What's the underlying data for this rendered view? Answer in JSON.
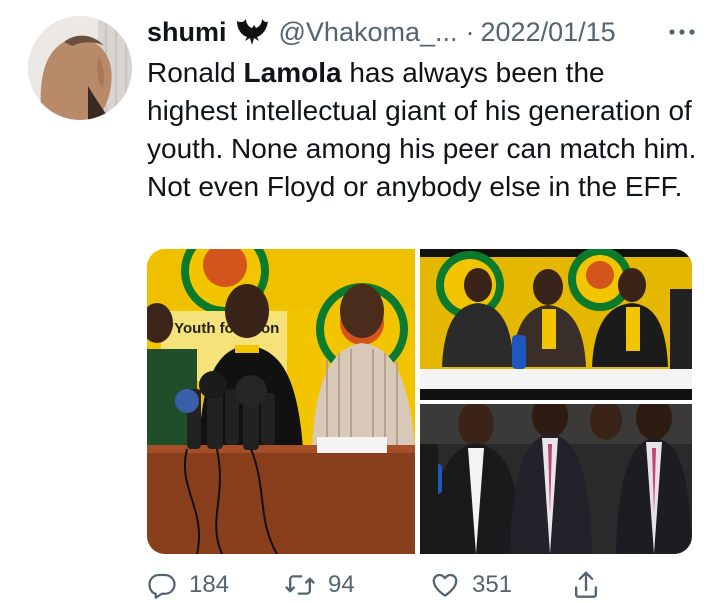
{
  "tweet": {
    "display_name": "shumi",
    "badge_icon": "bat-icon",
    "handle": "@Vhakoma_...",
    "separator": "·",
    "date": "2022/01/15",
    "text_before": "Ronald ",
    "text_bold": "Lamola",
    "text_after": " has always been the highest intellectual giant of his generation of youth. None among his peer can match him. Not even Floyd or anybody else in the EFF."
  },
  "media": {
    "photo_1_banner_text": "\"Youth  for Ec",
    "photo_1_banner_text_right": "on"
  },
  "actions": {
    "reply_count": "184",
    "retweet_count": "94",
    "like_count": "351"
  },
  "colors": {
    "secondary_text": "#536471",
    "primary_text": "#0f1419",
    "anc_yellow": "#f2c500",
    "anc_green": "#0c7a2c"
  }
}
